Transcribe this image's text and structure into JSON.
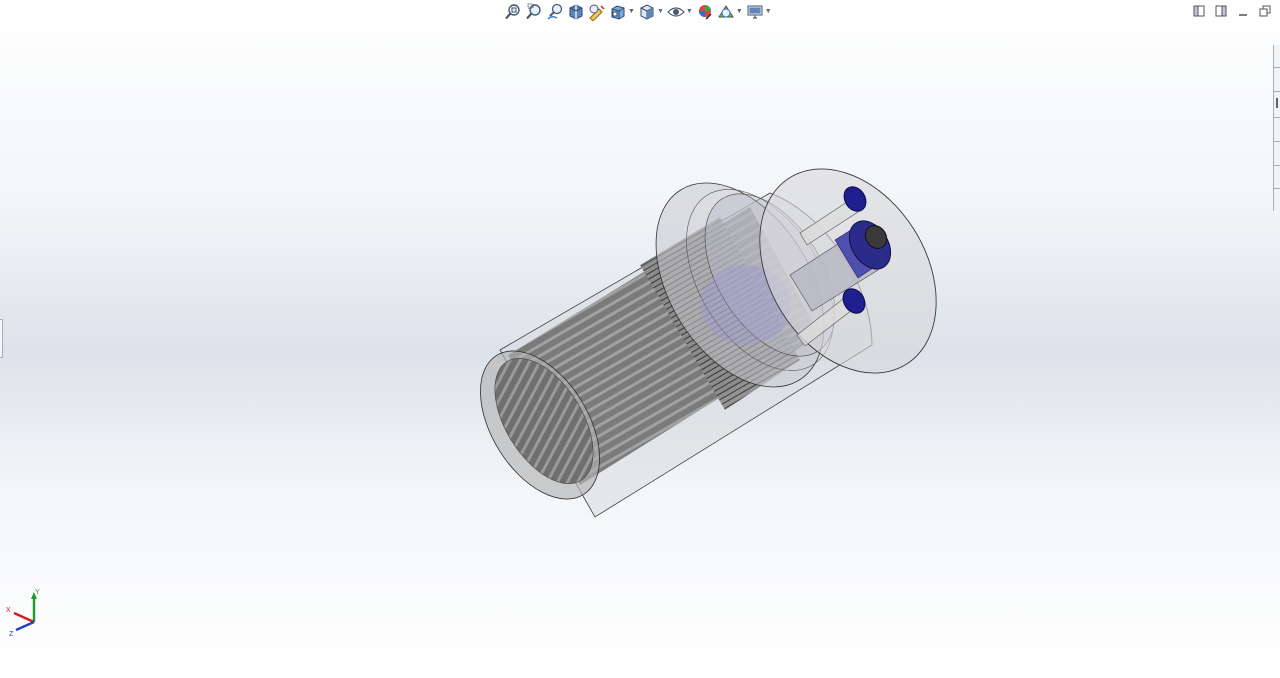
{
  "toolbar": {
    "buttons": [
      {
        "name": "zoom-to-fit",
        "icon": "zoom-fit-icon",
        "dropdown": false
      },
      {
        "name": "zoom-to-area",
        "icon": "zoom-area-icon",
        "dropdown": false
      },
      {
        "name": "previous-view",
        "icon": "previous-view-icon",
        "dropdown": false
      },
      {
        "name": "section-view",
        "icon": "section-view-icon",
        "dropdown": false
      },
      {
        "name": "dynamic-annotation-views",
        "icon": "annotation-views-icon",
        "dropdown": false
      },
      {
        "name": "view-orientation",
        "icon": "view-orientation-icon",
        "dropdown": true
      },
      {
        "name": "display-style",
        "icon": "display-style-icon",
        "dropdown": true
      },
      {
        "name": "hide-show-items",
        "icon": "hide-show-icon",
        "dropdown": true
      },
      {
        "name": "edit-appearance",
        "icon": "edit-appearance-icon",
        "dropdown": false
      },
      {
        "name": "apply-scene",
        "icon": "apply-scene-icon",
        "dropdown": true
      },
      {
        "name": "view-settings",
        "icon": "view-settings-icon",
        "dropdown": true
      }
    ]
  },
  "window_controls": [
    "tile-horizontal-icon",
    "tile-vertical-icon",
    "minimize-icon",
    "restore-icon"
  ],
  "triad": {
    "x_label": "X",
    "y_label": "Y",
    "z_label": "Z"
  },
  "colors": {
    "accent_blue": "#1f1f8f",
    "triad_x": "#d01e1e",
    "triad_y": "#1d9a2c",
    "triad_z": "#2440c8",
    "body_gray": "#6f6f6f"
  }
}
